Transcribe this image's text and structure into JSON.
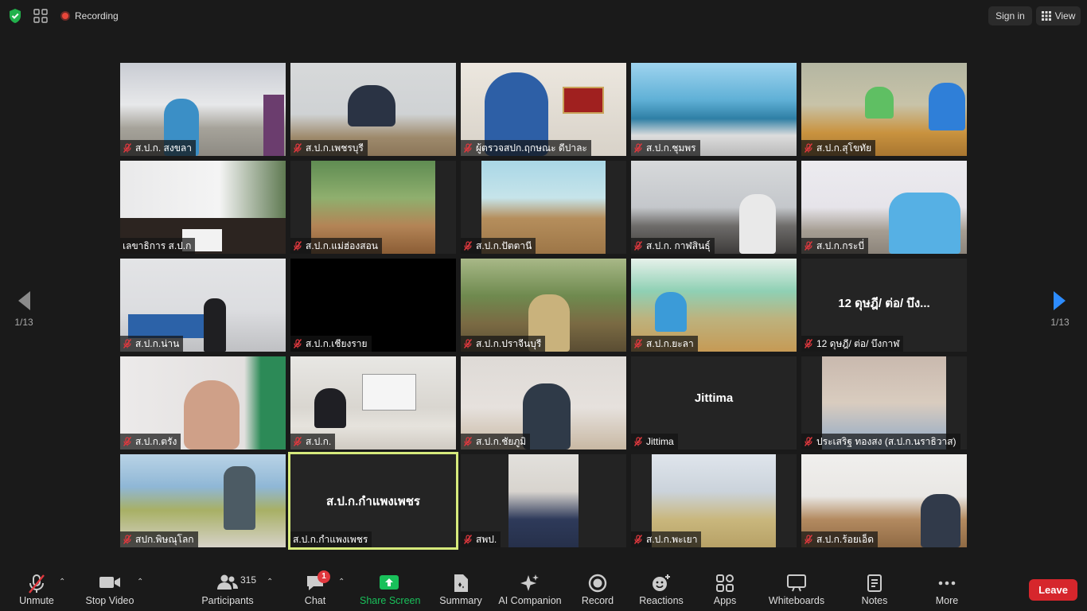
{
  "topbar": {
    "recording_label": "Recording",
    "signin_label": "Sign in",
    "view_label": "View"
  },
  "pager": {
    "left_label": "1/13",
    "right_label": "1/13"
  },
  "tiles": [
    {
      "name": "ส.ป.ก. สงขลา",
      "muted": true
    },
    {
      "name": "ส.ป.ก.เพชรบุรี",
      "muted": true
    },
    {
      "name": "ผู้ตรวจสปก.ฤกษณะ ดีปาละ",
      "muted": true
    },
    {
      "name": "ส.ป.ก.ชุมพร",
      "muted": true
    },
    {
      "name": "ส.ป.ก.สุโขทัย",
      "muted": true
    },
    {
      "name": "เลขาธิการ ส.ป.ก",
      "muted": false
    },
    {
      "name": "ส.ป.ก.แม่ฮ่องสอน",
      "muted": true
    },
    {
      "name": "ส.ป.ก.ปัตตานี",
      "muted": true
    },
    {
      "name": "ส.ป.ก. กาฬสินธุ์",
      "muted": true
    },
    {
      "name": "ส.ป.ก.กระบี่",
      "muted": true
    },
    {
      "name": "ส.ป.ก.น่าน",
      "muted": true
    },
    {
      "name": "ส.ป.ก.เชียงราย",
      "muted": true
    },
    {
      "name": "ส.ป.ก.ปราจีนบุรี",
      "muted": true
    },
    {
      "name": "ส.ป.ก.ยะลา",
      "muted": true
    },
    {
      "name": "12 ดุษฎี/ ต่อ/ บึงกาฬ",
      "muted": true,
      "display": "12 ดุษฎี/ ต่อ/ บึง..."
    },
    {
      "name": "ส.ป.ก.ตรัง",
      "muted": true
    },
    {
      "name": "ส.ป.ก.",
      "muted": true
    },
    {
      "name": "ส.ป.ก.ชัยภูมิ",
      "muted": true
    },
    {
      "name": "Jittima",
      "muted": true,
      "display": "Jittima"
    },
    {
      "name": "ประเสริฐ ทองสง (ส.ป.ก.นราธิวาส)",
      "muted": true
    },
    {
      "name": "สปก.พิษณุโลก",
      "muted": true
    },
    {
      "name": "ส.ป.ก.กำแพงเพชร",
      "muted": false,
      "display": "ส.ป.ก.กำแพงเพชร"
    },
    {
      "name": "สพป.",
      "muted": true
    },
    {
      "name": "ส.ป.ก.พะเยา",
      "muted": true
    },
    {
      "name": "ส.ป.ก.ร้อยเอ็ด",
      "muted": true
    }
  ],
  "toolbar": {
    "unmute": "Unmute",
    "stop_video": "Stop Video",
    "participants": "Participants",
    "participants_count": "315",
    "chat": "Chat",
    "chat_badge": "1",
    "share_screen": "Share Screen",
    "summary": "Summary",
    "ai_companion": "AI Companion",
    "record": "Record",
    "reactions": "Reactions",
    "apps": "Apps",
    "whiteboards": "Whiteboards",
    "notes": "Notes",
    "more": "More",
    "leave": "Leave"
  },
  "colors": {
    "background": "#1a1a1a",
    "active_speaker_border": "#d6ea7c",
    "share_green": "#19c05a",
    "leave_red": "#d6262c",
    "mute_red": "#e0383e",
    "accent_blue": "#2d8cff"
  }
}
